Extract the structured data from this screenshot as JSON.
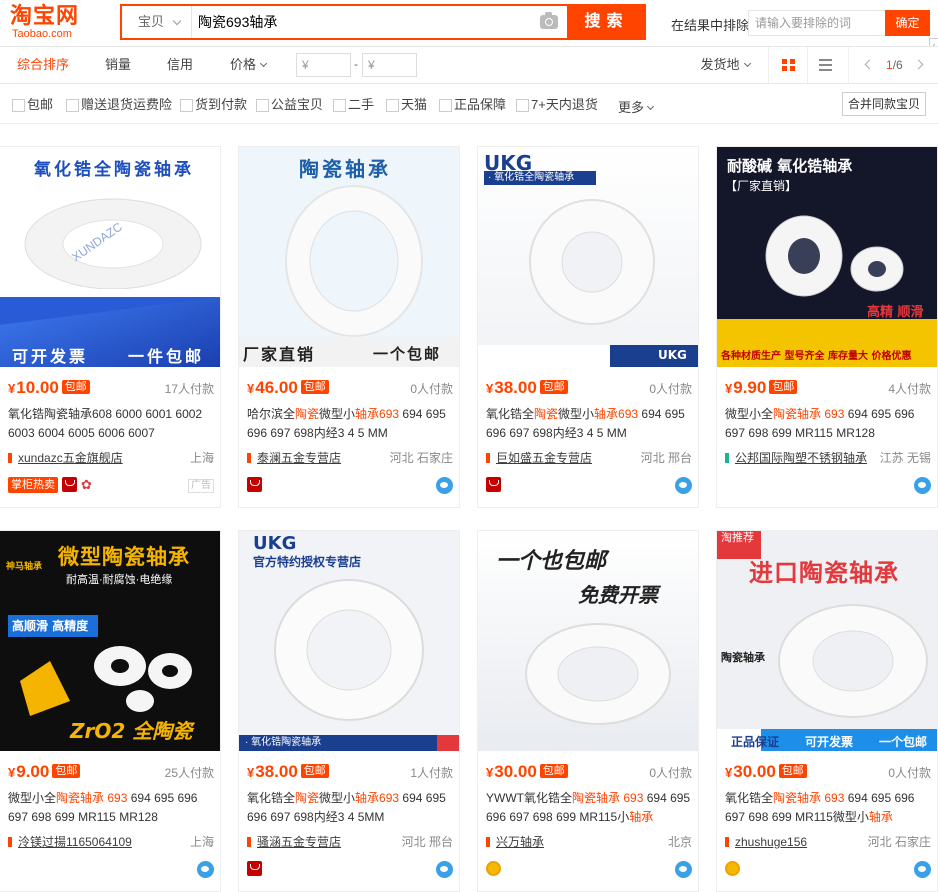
{
  "header": {
    "logo_cn": "淘宝网",
    "logo_en": "Taobao.com",
    "scope": "宝贝",
    "query": "陶瓷693轴承",
    "search_btn": "搜索",
    "exclude_label": "在结果中排除",
    "exclude_placeholder": "请输入要排除的词",
    "exclude_btn": "确定",
    "accent": "#ff4400"
  },
  "sortbar": {
    "tabs": [
      "综合排序",
      "销量",
      "信用",
      "价格"
    ],
    "price_from": "¥",
    "price_to": "¥",
    "dash": "-",
    "ship_from": "发货地",
    "page": "1",
    "pages": "/6"
  },
  "filters": {
    "items": [
      "包邮",
      "赠送退货运费险",
      "货到付款",
      "公益宝贝",
      "二手",
      "天猫",
      "正品保障",
      "7+天内退货"
    ],
    "more": "更多",
    "merge": "合并同款宝贝"
  },
  "products": [
    {
      "img_top": "氧化锆全陶瓷轴承",
      "img_bottom_left": "可开发票",
      "img_bottom_right": "一件包邮",
      "img_brand": "XUNDAZC",
      "price_symbol": "¥",
      "price": "10.00",
      "tag": "包邮",
      "sales": "17人付款",
      "title_pre": "氧化锆陶瓷轴承608 6000 6001 6002 6003 6004 6005 6006 6007",
      "title_hl": "",
      "title_post": "",
      "shop": "xundazc五金旗舰店",
      "loc": "上海",
      "badge": "掌柜热卖",
      "ad": "广告"
    },
    {
      "img_top": "陶瓷轴承",
      "img_bottom_left": "厂家直销",
      "img_bottom_right": "一个包邮",
      "price_symbol": "¥",
      "price": "46.00",
      "tag": "包邮",
      "sales": "0人付款",
      "title_pre": "哈尔滨全",
      "title_hl": "陶瓷",
      "title_mid": "微型小",
      "title_hl2": "轴承693",
      "title_post": " 694 695 696 697 698内经3 4 5 MM",
      "shop": "泰澜五金专营店",
      "loc": "河北 石家庄"
    },
    {
      "img_brand": "UKG",
      "img_sub": "· 氧化锆全陶瓷轴承",
      "img_corner": "UKG",
      "price_symbol": "¥",
      "price": "38.00",
      "tag": "包邮",
      "sales": "0人付款",
      "title_pre": "氧化锆全",
      "title_hl": "陶瓷",
      "title_mid": "微型小",
      "title_hl2": "轴承693",
      "title_post": " 694 695 696 697 698内经3 4 5 MM",
      "shop": "巨如盛五金专营店",
      "loc": "河北 邢台"
    },
    {
      "img_top": "耐酸碱 氧化锆轴承",
      "img_sub": "【厂家直销】",
      "img_mid": "高精 顺滑",
      "img_bottom": "各种材质生产 型号齐全 库存量大 价格优惠",
      "price_symbol": "¥",
      "price": "9.90",
      "tag": "包邮",
      "sales": "4人付款",
      "title_pre": "微型小全",
      "title_hl": "陶瓷轴承",
      "title_mid": " ",
      "title_hl2": "693",
      "title_post": " 694 695 696 697 698 699 MR115 MR128",
      "shop": "公邦国际陶塑不锈钢轴承",
      "loc": "江苏 无锡"
    },
    {
      "img_logo": "神马轴承",
      "img_top": "微型陶瓷轴承",
      "img_sub": "耐高温·耐腐蚀·电绝缘",
      "img_mid": "高顺滑 高精度",
      "img_bottom": "ZrO2 全陶瓷",
      "price_symbol": "¥",
      "price": "9.00",
      "tag": "包邮",
      "sales": "25人付款",
      "title_pre": "微型小全",
      "title_hl": "陶瓷轴承",
      "title_mid": " ",
      "title_hl2": "693",
      "title_post": " 694 695 696 697 698 699 MR115 MR128",
      "shop": "泠镁过揚1165064109",
      "loc": "上海"
    },
    {
      "img_brand": "UKG",
      "img_sub": "官方特约授权专营店",
      "img_bottom": "· 氧化锆陶瓷轴承",
      "price_symbol": "¥",
      "price": "38.00",
      "tag": "包邮",
      "sales": "1人付款",
      "title_pre": "氧化锆全",
      "title_hl": "陶瓷",
      "title_mid": "微型小",
      "title_hl2": "轴承693",
      "title_post": " 694 695 696 697 698内经3 4 5MM",
      "shop": "骚涵五金专营店",
      "loc": "河北 邢台"
    },
    {
      "img_top": "一个也包邮",
      "img_sub": "免费开票",
      "price_symbol": "¥",
      "price": "30.00",
      "tag": "包邮",
      "sales": "0人付款",
      "title_pre": "YWWT氧化锆全",
      "title_hl": "陶瓷轴承",
      "title_mid": " ",
      "title_hl2": "693",
      "title_post": " 694 695 696 697 698 699 MR115小",
      "title_hl3": "轴承",
      "shop": "兴万轴承",
      "loc": "北京"
    },
    {
      "img_corner": "淘推荐",
      "img_top": "进口陶瓷轴承",
      "img_mid": "陶瓷轴承",
      "img_bottom_left": "正品保证",
      "img_bottom_mid": "可开发票",
      "img_bottom_right": "一个包邮",
      "price_symbol": "¥",
      "price": "30.00",
      "tag": "包邮",
      "sales": "0人付款",
      "title_pre": "氧化锆全",
      "title_hl": "陶瓷轴承",
      "title_mid": " ",
      "title_hl2": "693",
      "title_post": " 694 695 696 697 698 699 MR115微型小",
      "title_hl3": "轴承",
      "shop": "zhushuge156",
      "loc": "河北 石家庄"
    }
  ]
}
